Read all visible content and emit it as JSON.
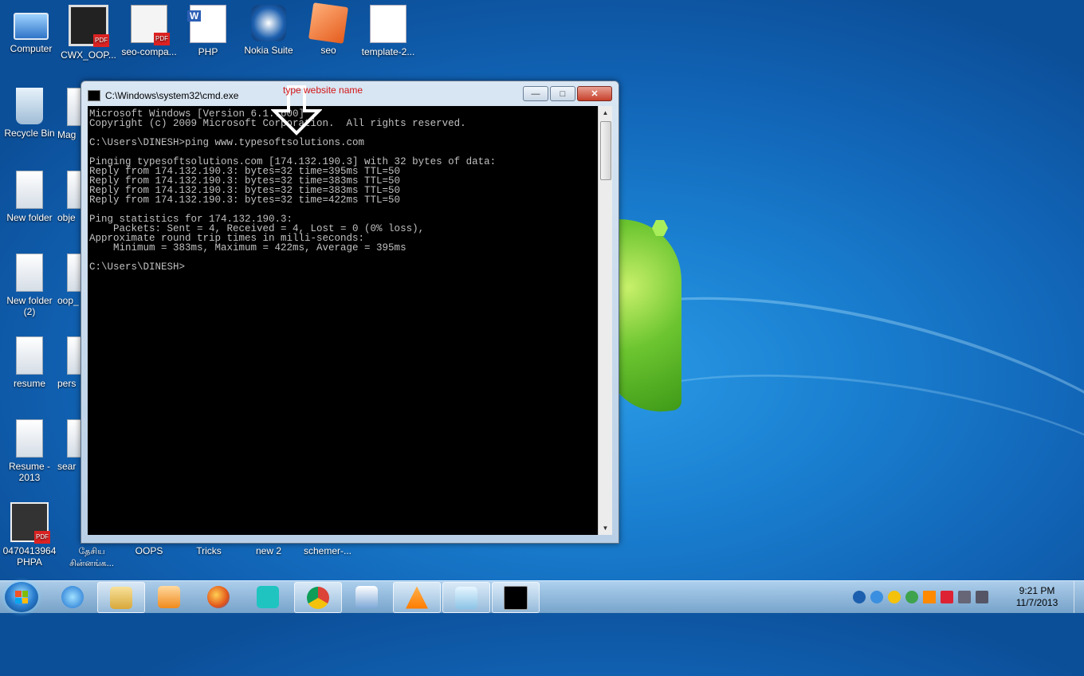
{
  "desktop": {
    "icons": [
      {
        "label": "Computer"
      },
      {
        "label": "CWX_OOP..."
      },
      {
        "label": "seo-compa..."
      },
      {
        "label": "PHP"
      },
      {
        "label": "Nokia Suite"
      },
      {
        "label": "seo"
      },
      {
        "label": "template-2..."
      },
      {
        "label": "Recycle Bin"
      },
      {
        "label": "Mag"
      },
      {
        "label": "New folder"
      },
      {
        "label": "obje"
      },
      {
        "label": "New folder (2)"
      },
      {
        "label": "oop_"
      },
      {
        "label": "resume"
      },
      {
        "label": "pers"
      },
      {
        "label": "Resume - 2013"
      },
      {
        "label": "sear"
      },
      {
        "label": "0470413964 PHPA"
      },
      {
        "label": "தேசிய சின்னங்க..."
      },
      {
        "label": "OOPS"
      },
      {
        "label": "Tricks"
      },
      {
        "label": "new 2"
      },
      {
        "label": "schemer-..."
      }
    ]
  },
  "cmd_window": {
    "title": "C:\\Windows\\system32\\cmd.exe",
    "lines": [
      "Microsoft Windows [Version 6.1.7600]",
      "Copyright (c) 2009 Microsoft Corporation.  All rights reserved.",
      "",
      "C:\\Users\\DINESH>ping www.typesoftsolutions.com",
      "",
      "Pinging typesoftsolutions.com [174.132.190.3] with 32 bytes of data:",
      "Reply from 174.132.190.3: bytes=32 time=395ms TTL=50",
      "Reply from 174.132.190.3: bytes=32 time=383ms TTL=50",
      "Reply from 174.132.190.3: bytes=32 time=383ms TTL=50",
      "Reply from 174.132.190.3: bytes=32 time=422ms TTL=50",
      "",
      "Ping statistics for 174.132.190.3:",
      "    Packets: Sent = 4, Received = 4, Lost = 0 (0% loss),",
      "Approximate round trip times in milli-seconds:",
      "    Minimum = 383ms, Maximum = 422ms, Average = 395ms",
      "",
      "C:\\Users\\DINESH>"
    ]
  },
  "annotation": {
    "text": "type website name",
    "color": "#d21414"
  },
  "taskbar": {
    "apps": [
      {
        "icon": "internet-explorer-icon"
      },
      {
        "icon": "file-explorer-icon"
      },
      {
        "icon": "media-player-icon"
      },
      {
        "icon": "firefox-icon"
      },
      {
        "icon": "remote-desktop-icon"
      },
      {
        "icon": "chrome-icon"
      },
      {
        "icon": "email-client-icon"
      },
      {
        "icon": "vlc-icon"
      },
      {
        "icon": "notepad-icon"
      },
      {
        "icon": "command-prompt-icon"
      }
    ],
    "clock_time": "9:21 PM",
    "clock_date": "11/7/2013"
  }
}
